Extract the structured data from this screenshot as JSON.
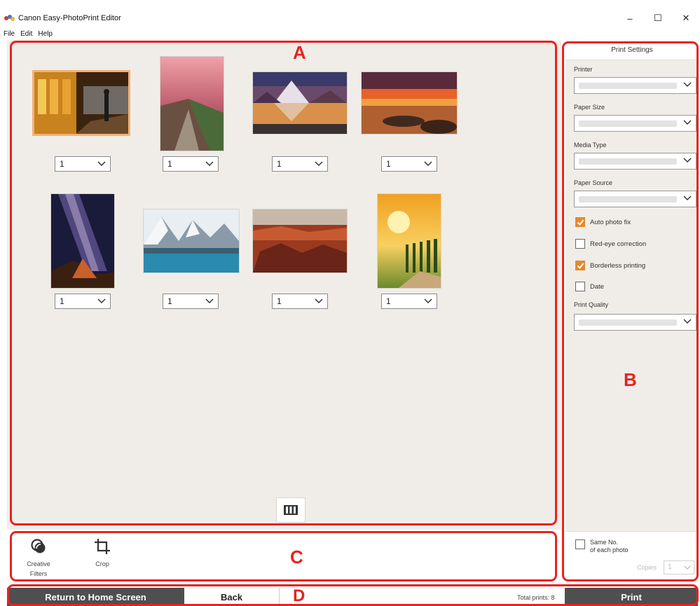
{
  "window": {
    "title": "Canon Easy-PhotoPrint Editor",
    "minimize": "–",
    "maximize": "☐",
    "close": "✕"
  },
  "menu": [
    "File",
    "Edit",
    "Help"
  ],
  "photos": [
    {
      "quantity": "1",
      "selected": true
    },
    {
      "quantity": "1",
      "selected": false
    },
    {
      "quantity": "1",
      "selected": false
    },
    {
      "quantity": "1",
      "selected": false
    },
    {
      "quantity": "1",
      "selected": false
    },
    {
      "quantity": "1",
      "selected": false
    },
    {
      "quantity": "1",
      "selected": false
    },
    {
      "quantity": "1",
      "selected": false
    }
  ],
  "print_settings": {
    "title": "Print Settings",
    "printer_label": "Printer",
    "paper_size_label": "Paper Size",
    "media_type_label": "Media Type",
    "paper_source_label": "Paper Source",
    "auto_photo_fix": {
      "label": "Auto photo fix",
      "checked": true
    },
    "red_eye": {
      "label": "Red-eye correction",
      "checked": false
    },
    "borderless": {
      "label": "Borderless printing",
      "checked": true
    },
    "date": {
      "label": "Date",
      "checked": false
    },
    "print_quality_label": "Print Quality",
    "same_no_line1": "Same No.",
    "same_no_line2": "of each photo",
    "copies_label": "Copies",
    "copies_value": "1"
  },
  "tools": {
    "creative_filters_line1": "Creative",
    "creative_filters_line2": "Filters",
    "crop": "Crop"
  },
  "bottom": {
    "home": "Return to Home Screen",
    "back": "Back",
    "total_prints": "Total prints: 8",
    "print": "Print"
  },
  "annotations": {
    "a": "A",
    "b": "B",
    "c": "C",
    "d": "D"
  },
  "colors": {
    "annotation": "#e8231d",
    "checkbox_accent": "#e48a2c",
    "dark_button": "#4f4f4f",
    "canvas_bg": "#f0ede9"
  }
}
